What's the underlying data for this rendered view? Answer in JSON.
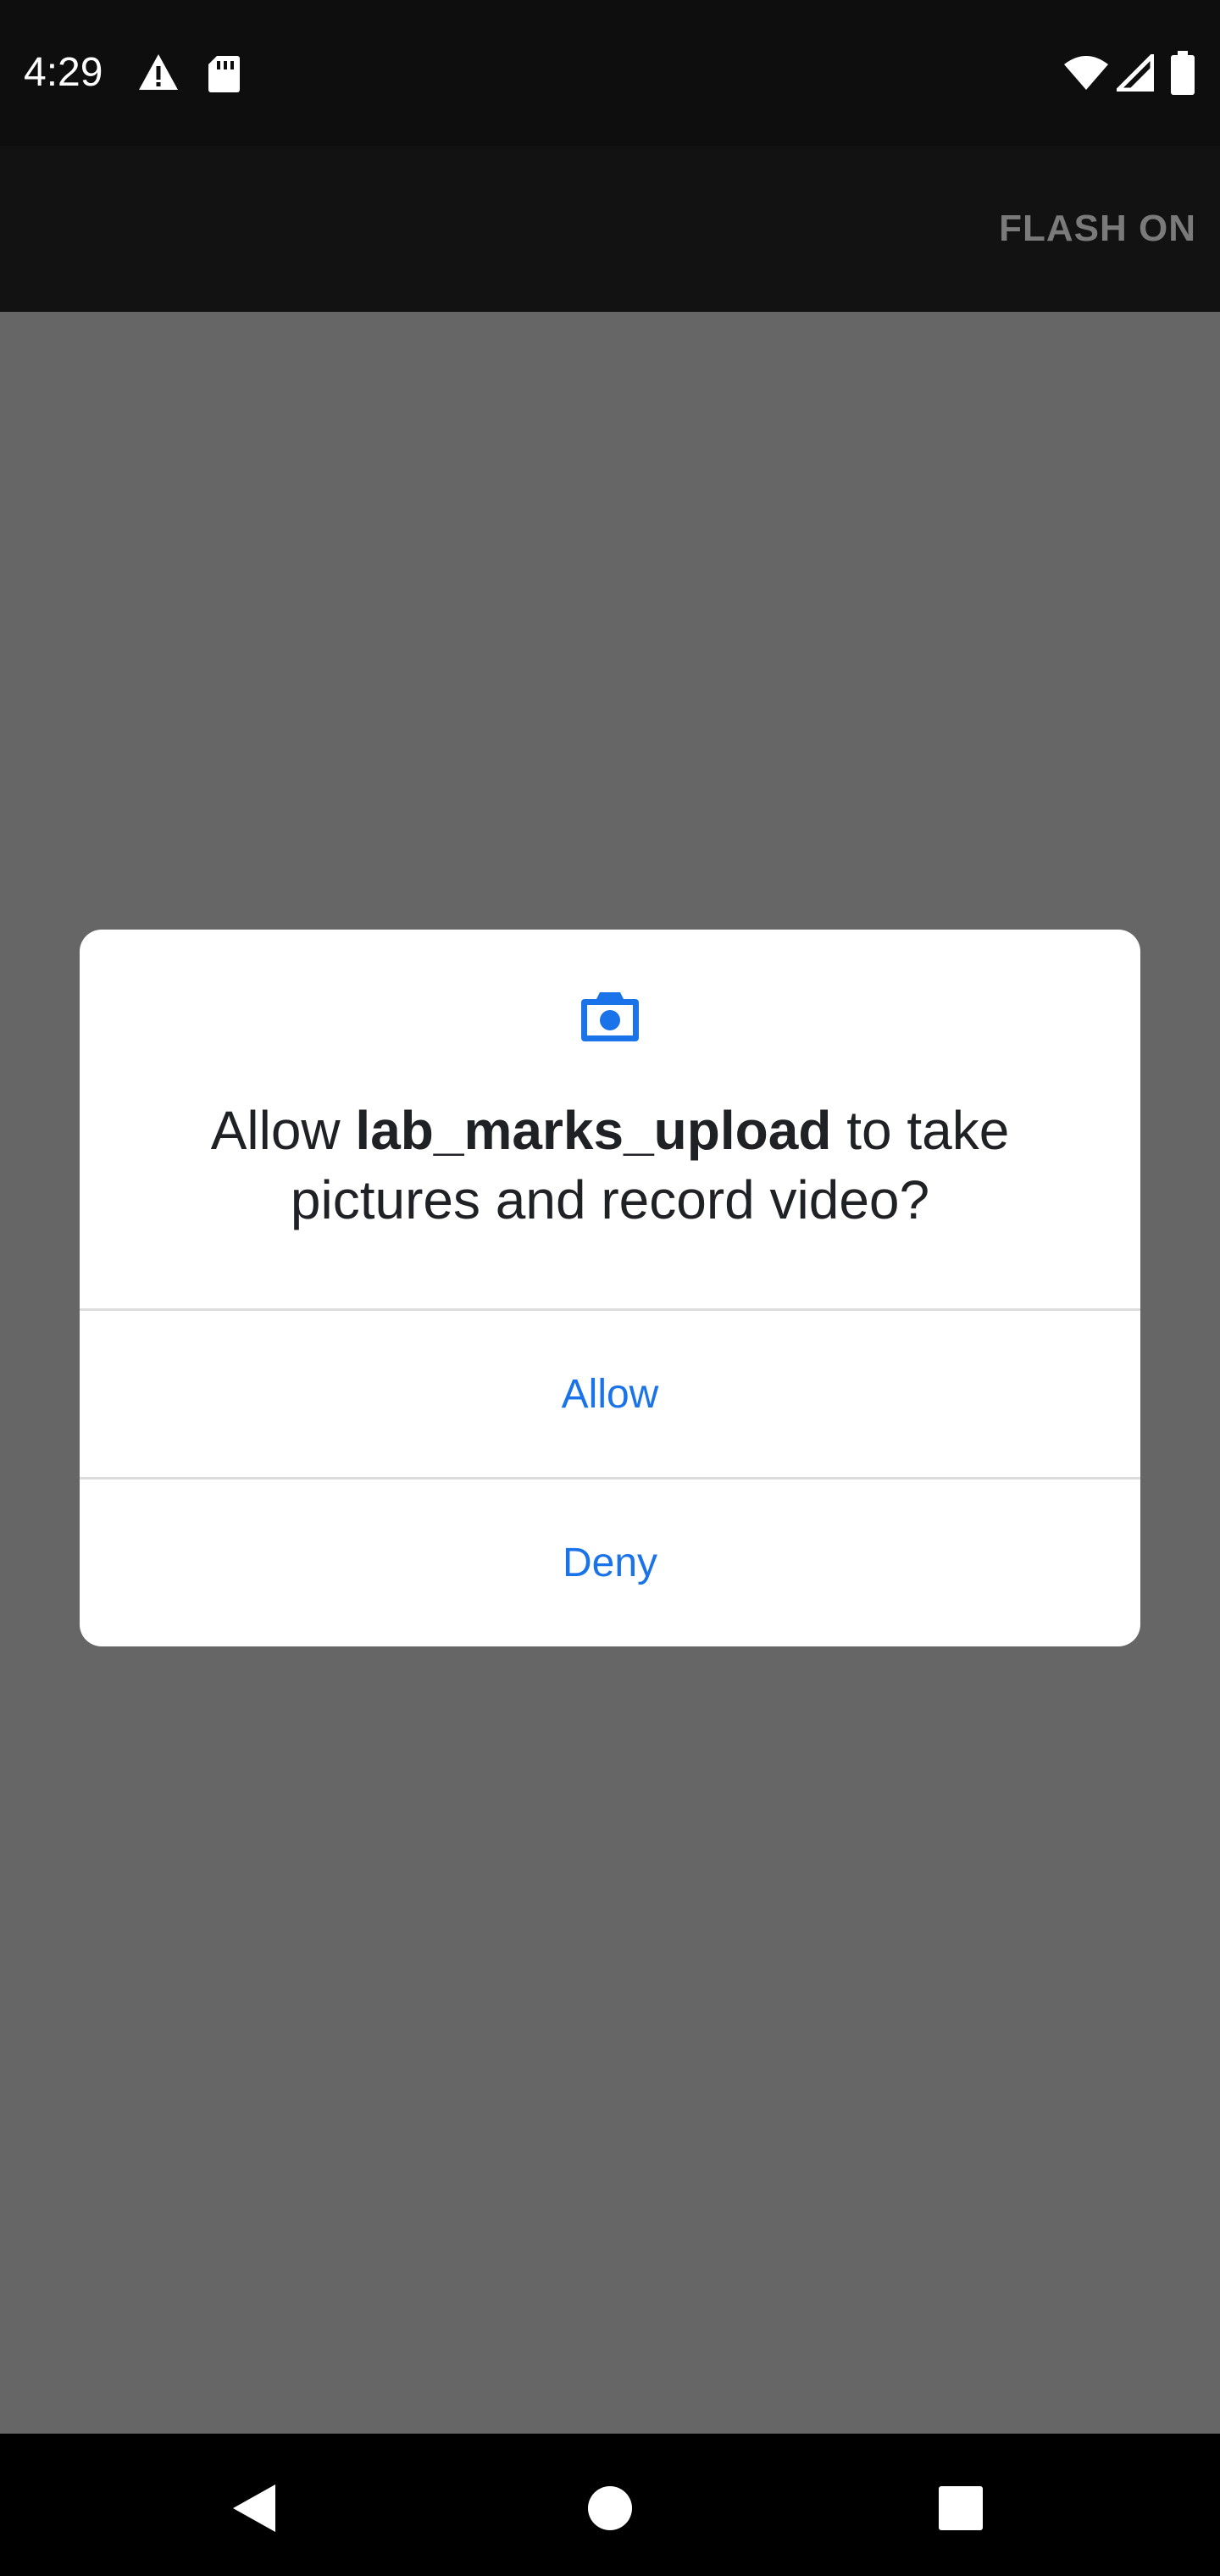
{
  "status_bar": {
    "time": "4:29",
    "icons": [
      "warning-icon",
      "sd-card-icon",
      "wifi-icon",
      "cell-signal-icon",
      "battery-icon"
    ]
  },
  "app_bar": {
    "flash_label": "FLASH ON"
  },
  "dialog": {
    "icon": "camera-icon",
    "title_prefix": "Allow ",
    "app_name": "lab_marks_upload",
    "title_suffix": " to take pictures and record video?",
    "allow_label": "Allow",
    "deny_label": "Deny"
  },
  "navigation": {
    "icons": [
      "back-icon",
      "home-icon",
      "recents-icon"
    ]
  },
  "colors": {
    "accent": "#1a73e8",
    "scrim": "#666666",
    "app_bar": "#121212",
    "status_bar": "#0e0e0e"
  }
}
